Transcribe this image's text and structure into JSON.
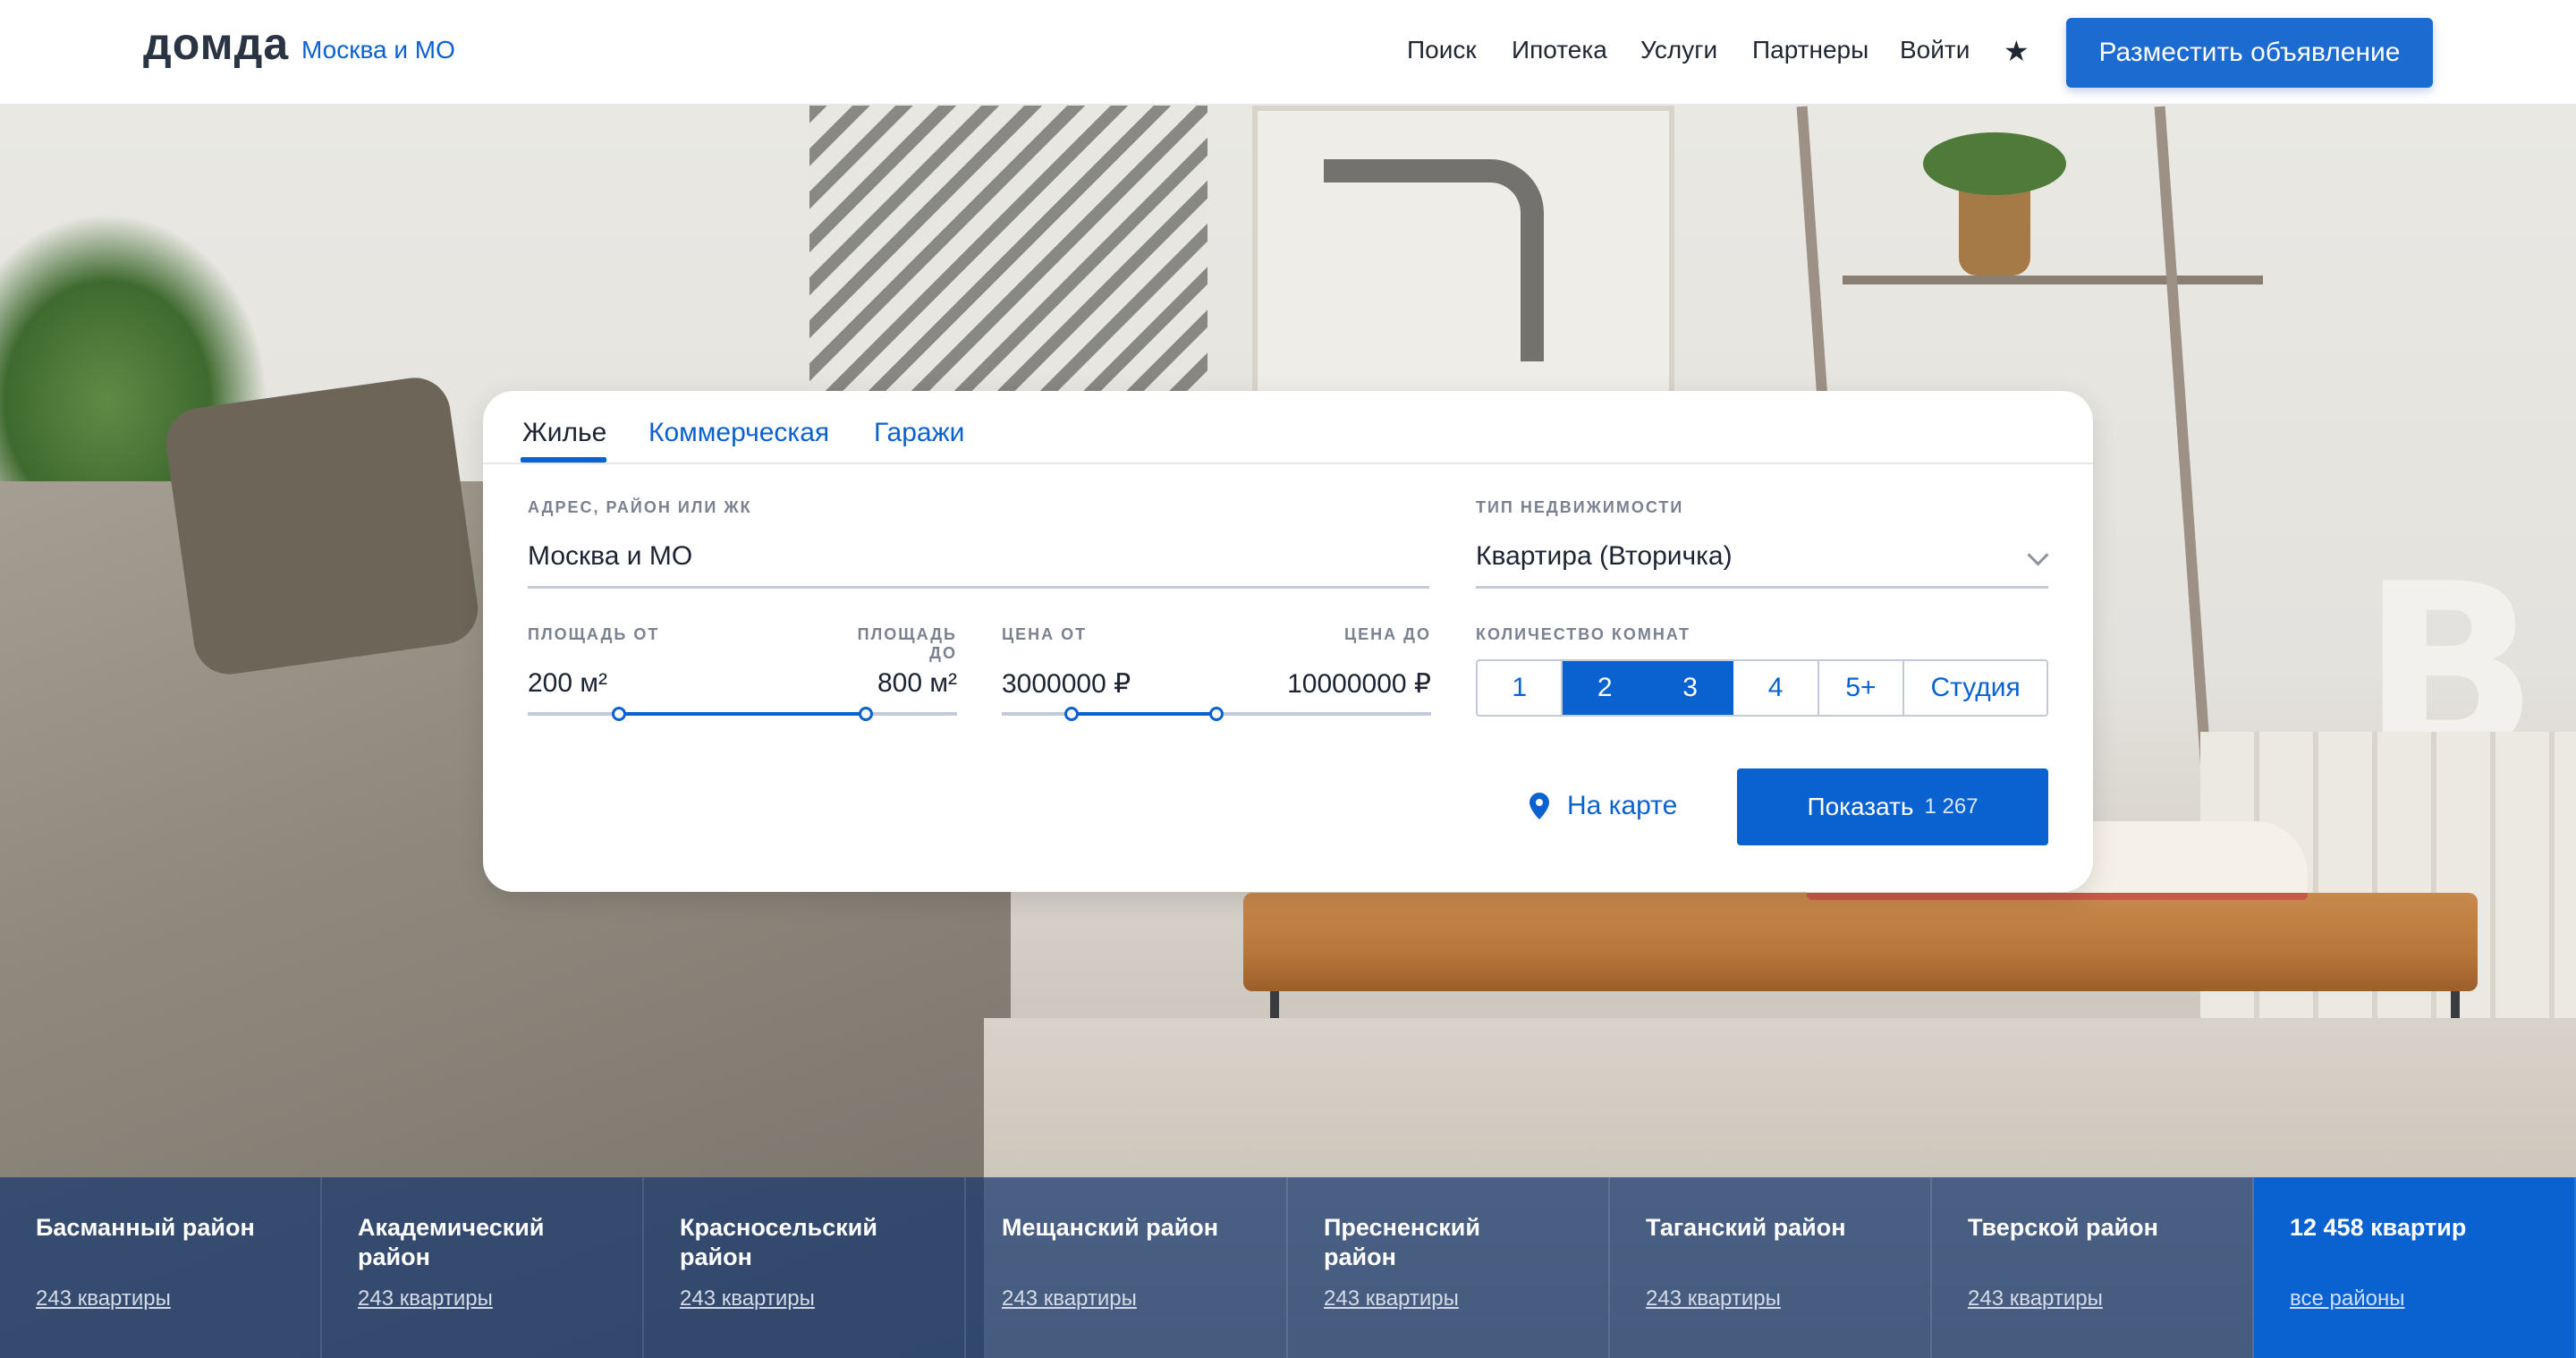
{
  "header": {
    "logo": "домда",
    "region": "Москва и МО",
    "nav": [
      "Поиск",
      "Ипотека",
      "Услуги",
      "Партнеры",
      "Войти"
    ],
    "favorites_icon": "star-icon",
    "post_button": "Разместить объявление"
  },
  "search": {
    "tabs": [
      "Жилье",
      "Коммерческая",
      "Гаражи"
    ],
    "active_tab": "Жилье",
    "address": {
      "label": "Адрес, район или ЖК",
      "value": "Москва и МО"
    },
    "property_type": {
      "label": "Тип недвижимости",
      "value": "Квартира (Вторичка)"
    },
    "area": {
      "label_from": "Площадь от",
      "label_to": "Площадь до",
      "from": "200 м²",
      "to": "800 м²"
    },
    "price": {
      "label_from": "Цена от",
      "label_to": "Цена до",
      "from": "3000000 ₽",
      "to": "10000000 ₽"
    },
    "rooms": {
      "label": "Количество комнат",
      "options": [
        "1",
        "2",
        "3",
        "4",
        "5+",
        "Студия"
      ],
      "selected": [
        "2",
        "3"
      ]
    },
    "map_link": "На карте",
    "show_button": {
      "label": "Показать",
      "count": "1 267"
    }
  },
  "districts": [
    {
      "name": "Басманный район",
      "count": "243 квартиры"
    },
    {
      "name": "Академический район",
      "count": "243 квартиры"
    },
    {
      "name": "Красносельский район",
      "count": "243 квартиры"
    },
    {
      "name": "Мещанский район",
      "count": "243 квартиры"
    },
    {
      "name": "Пресненский район",
      "count": "243 квартиры"
    },
    {
      "name": "Таганский район",
      "count": "243 квартиры"
    },
    {
      "name": "Тверской район",
      "count": "243 квартиры"
    }
  ],
  "total": {
    "name": "12 458 квартир",
    "link": "все районы"
  },
  "colors": {
    "accent": "#0a62d0",
    "text": "#1c2433",
    "district_overlay": "#16386e"
  }
}
